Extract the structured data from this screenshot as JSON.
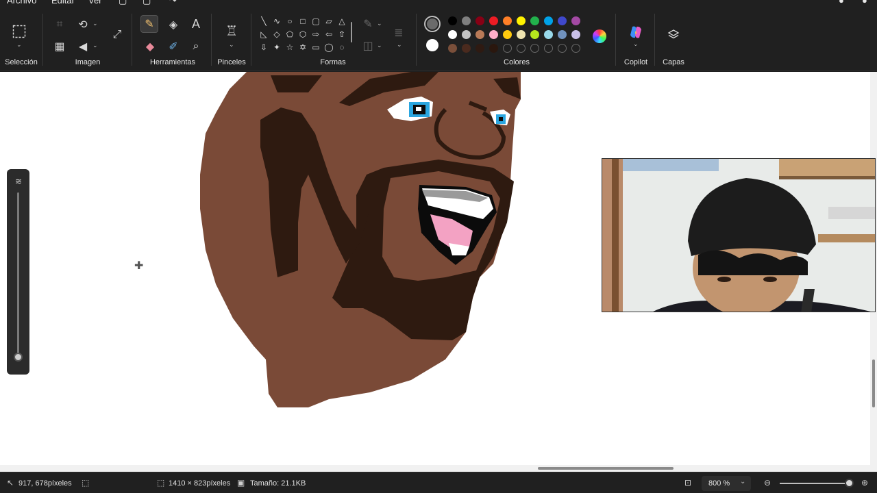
{
  "menu": {
    "items": [
      "Archivo",
      "Editar",
      "Ver"
    ]
  },
  "ribbon": {
    "groups": {
      "seleccion": "Selección",
      "imagen": "Imagen",
      "herramientas": "Herramientas",
      "pinceles": "Pinceles",
      "formas": "Formas",
      "colores": "Colores",
      "copilot": "Copilot",
      "capas": "Capas"
    },
    "text_tool_glyph": "A"
  },
  "colors": {
    "primary": "#6b6b6b",
    "secondary": "#ffffff",
    "palette_row1": [
      "#000000",
      "#7f7f7f",
      "#880015",
      "#ed1c24",
      "#ff7f27",
      "#fff200",
      "#22b14c",
      "#00a2e8",
      "#3f48cc",
      "#a349a4"
    ],
    "palette_row2": [
      "#ffffff",
      "#c3c3c3",
      "#b97a57",
      "#ffaec9",
      "#ffc90e",
      "#efe4b0",
      "#b5e61d",
      "#99d9ea",
      "#7092be",
      "#c8bfe7"
    ],
    "palette_row3": [
      "#7a4f3a",
      "#4a2a1e",
      "#2e1a12",
      "#2a170e",
      "",
      "",
      "",
      "",
      "",
      ""
    ]
  },
  "status": {
    "cursor_position": "917, 678píxeles",
    "canvas_size": "1410 × 823píxeles",
    "file_size": "Tamaño: 21.1KB",
    "zoom": "800 %"
  },
  "webcam": {
    "label": "webcam-overlay"
  }
}
